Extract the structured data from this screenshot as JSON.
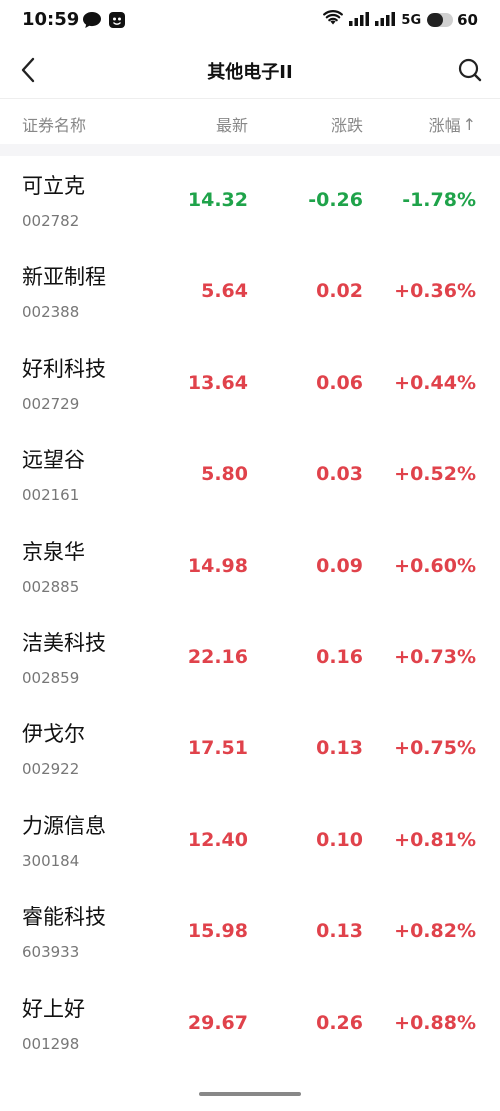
{
  "status_bar": {
    "time": "10:59",
    "network": "5G",
    "battery_text": "60",
    "battery_level": 0.6
  },
  "nav": {
    "title": "其他电子II"
  },
  "table_header": {
    "name": "证券名称",
    "price": "最新",
    "change": "涨跌",
    "pct": "涨幅",
    "sort_arrow": "↑"
  },
  "colors": {
    "up": "#e0424b",
    "down": "#1fa34a"
  },
  "stocks": [
    {
      "name": "可立克",
      "code": "002782",
      "price": "14.32",
      "change": "-0.26",
      "pct": "-1.78%",
      "dir": "down"
    },
    {
      "name": "新亚制程",
      "code": "002388",
      "price": "5.64",
      "change": "0.02",
      "pct": "+0.36%",
      "dir": "up"
    },
    {
      "name": "好利科技",
      "code": "002729",
      "price": "13.64",
      "change": "0.06",
      "pct": "+0.44%",
      "dir": "up"
    },
    {
      "name": "远望谷",
      "code": "002161",
      "price": "5.80",
      "change": "0.03",
      "pct": "+0.52%",
      "dir": "up"
    },
    {
      "name": "京泉华",
      "code": "002885",
      "price": "14.98",
      "change": "0.09",
      "pct": "+0.60%",
      "dir": "up"
    },
    {
      "name": "洁美科技",
      "code": "002859",
      "price": "22.16",
      "change": "0.16",
      "pct": "+0.73%",
      "dir": "up"
    },
    {
      "name": "伊戈尔",
      "code": "002922",
      "price": "17.51",
      "change": "0.13",
      "pct": "+0.75%",
      "dir": "up"
    },
    {
      "name": "力源信息",
      "code": "300184",
      "price": "12.40",
      "change": "0.10",
      "pct": "+0.81%",
      "dir": "up"
    },
    {
      "name": "睿能科技",
      "code": "603933",
      "price": "15.98",
      "change": "0.13",
      "pct": "+0.82%",
      "dir": "up"
    },
    {
      "name": "好上好",
      "code": "001298",
      "price": "29.67",
      "change": "0.26",
      "pct": "+0.88%",
      "dir": "up"
    }
  ]
}
